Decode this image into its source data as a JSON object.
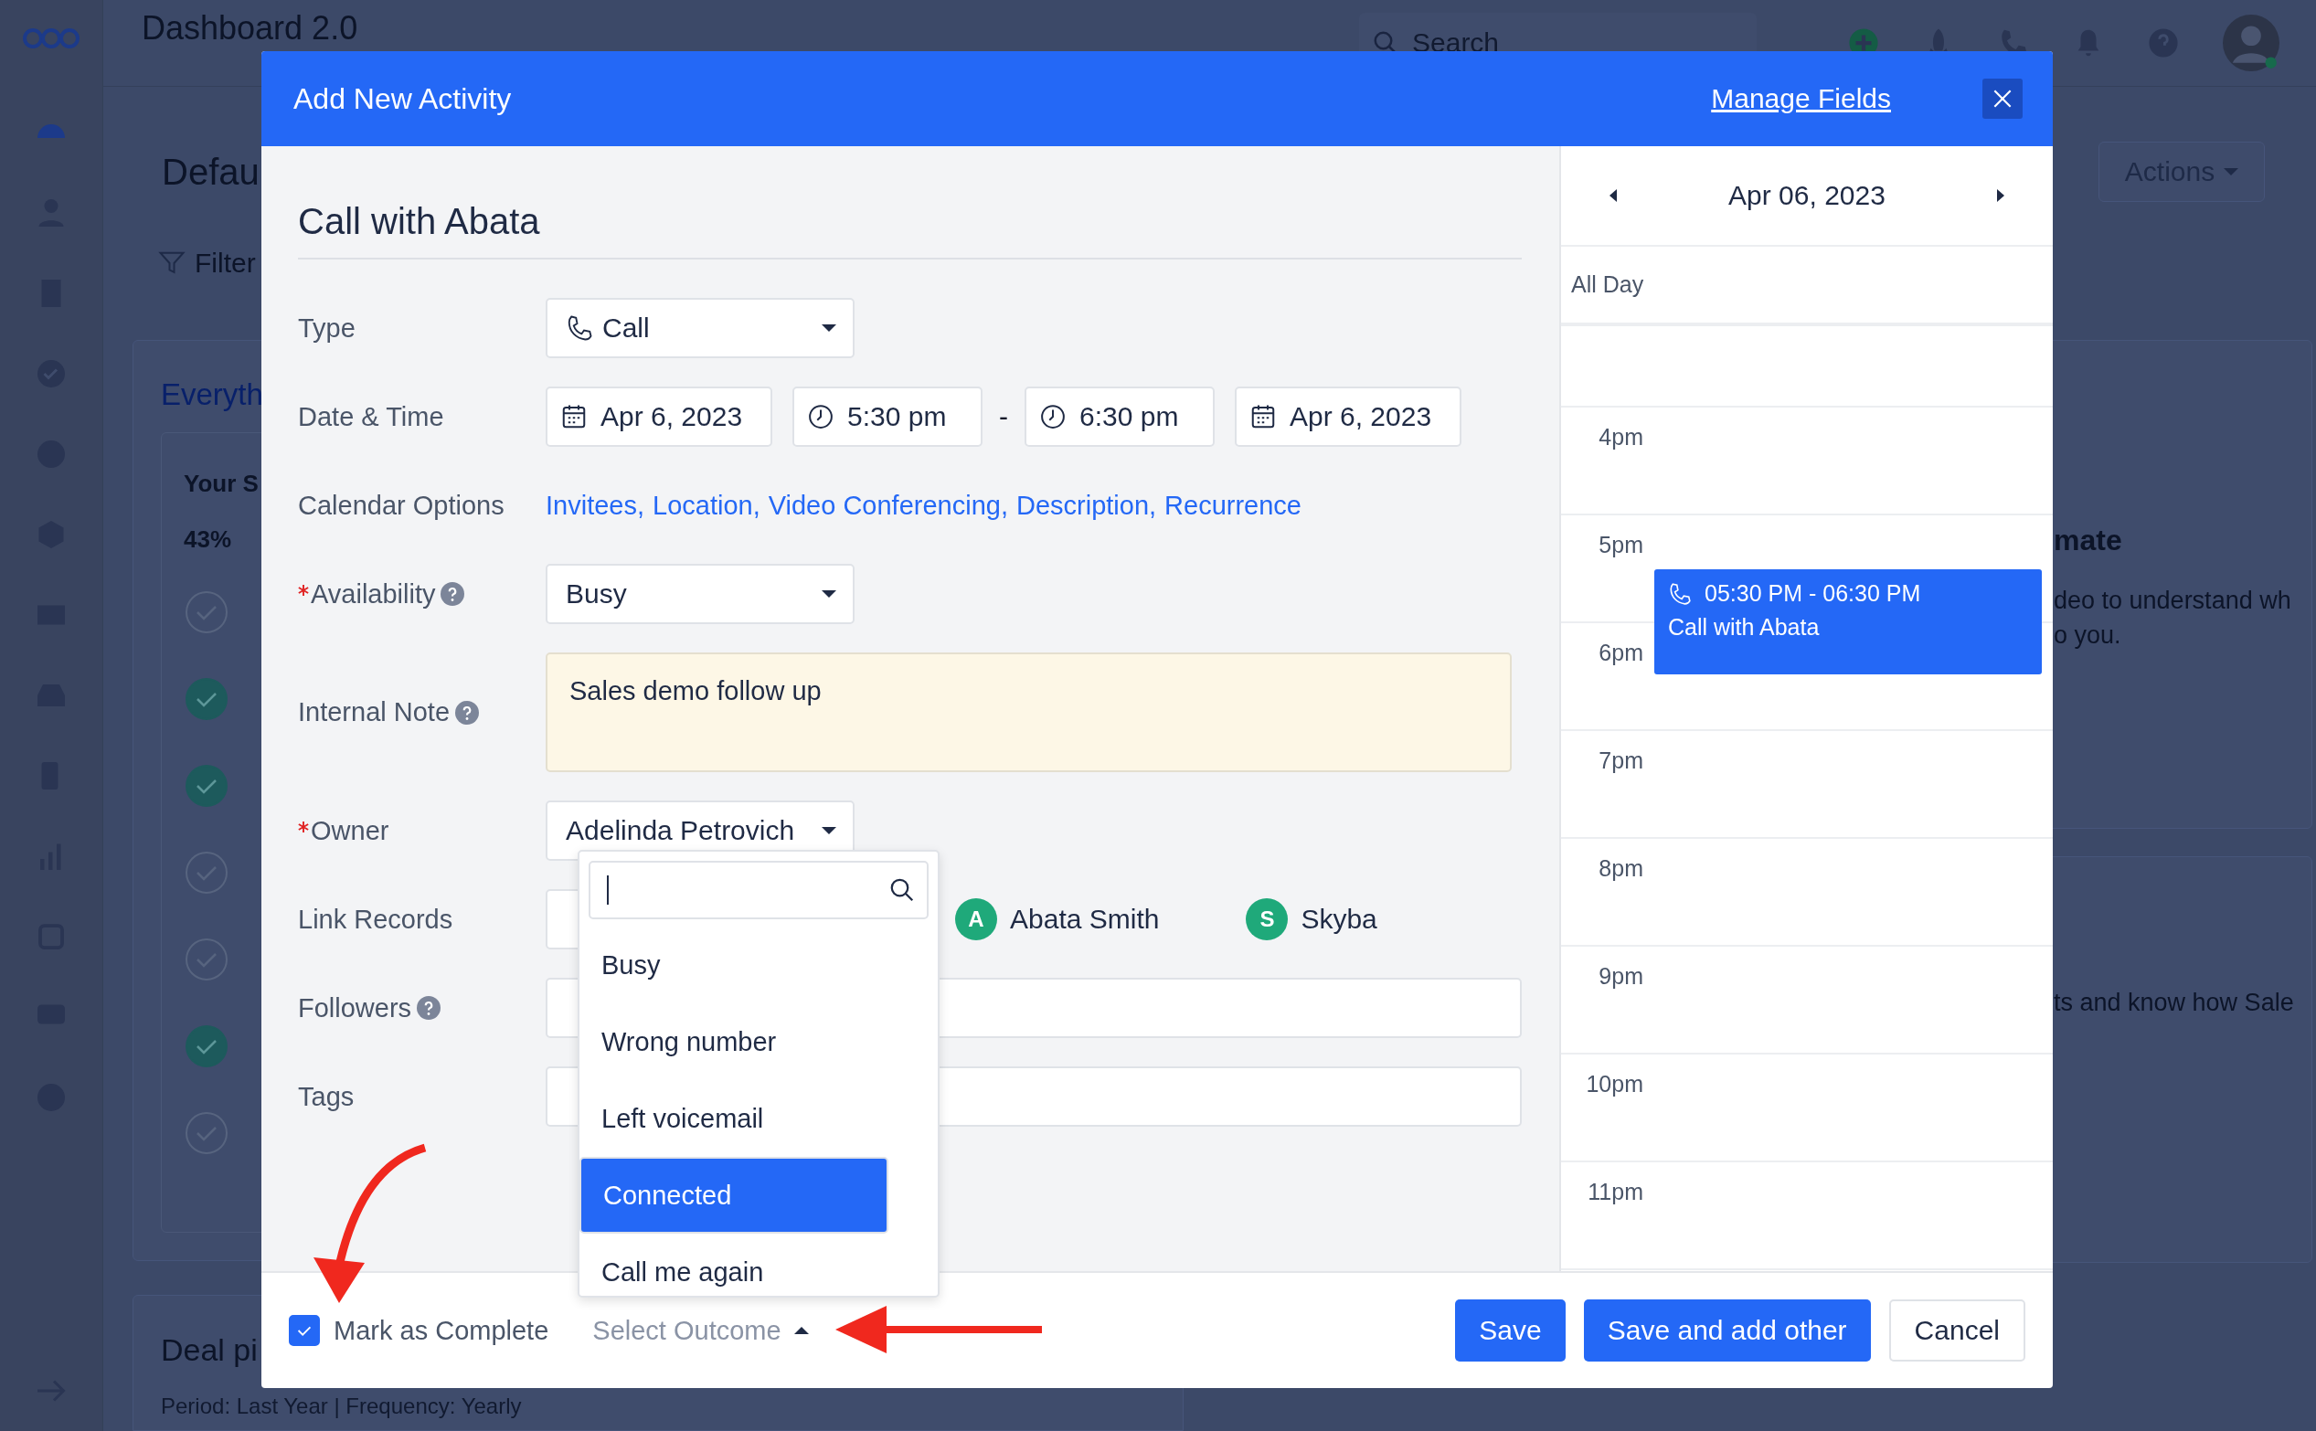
{
  "app": {
    "title": "Dashboard 2.0",
    "search": {
      "placeholder": "Search"
    }
  },
  "background": {
    "page_title": "Defau",
    "filter": "Filter",
    "actions": "Actions",
    "section_title": "Everyth",
    "subcard_title": "Your S",
    "progress": "43%",
    "checklist": [
      {
        "checked": false
      },
      {
        "checked": true
      },
      {
        "checked": true
      },
      {
        "checked": false
      },
      {
        "checked": false
      },
      {
        "checked": true
      },
      {
        "checked": false
      }
    ],
    "right_card": {
      "title": "mate",
      "lines": [
        "deo to understand wh",
        "o you."
      ]
    },
    "right_card_2": {
      "text": "ts and know how Sale"
    },
    "deal_title": "Deal pi",
    "deal_period": "Period: Last Year | Frequency: Yearly"
  },
  "modal": {
    "title": "Add New Activity",
    "manage_fields": "Manage Fields",
    "activity_title": "Call with Abata",
    "rows": [
      {
        "kind": "type-select",
        "label": "Type",
        "required": false,
        "help": false,
        "value": "Call"
      },
      {
        "kind": "datetime",
        "label": "Date & Time",
        "required": false,
        "help": false,
        "start_date": "Apr 6, 2023",
        "start_time": "5:30 pm",
        "separator": "-",
        "end_time": "6:30 pm",
        "end_date": "Apr 6, 2023"
      },
      {
        "kind": "links",
        "label": "Calendar Options",
        "required": false,
        "help": false,
        "links": [
          "Invitees,",
          "Location,",
          "Video Conferencing,",
          "Description,",
          "Recurrence"
        ]
      },
      {
        "kind": "select",
        "label": "Availability",
        "required": true,
        "help": true,
        "value": "Busy"
      },
      {
        "kind": "note",
        "label": "Internal Note",
        "required": false,
        "help": true,
        "value": "Sales demo follow up"
      },
      {
        "kind": "select",
        "label": "Owner",
        "required": true,
        "help": false,
        "value": "Adelinda Petrovich"
      },
      {
        "kind": "records",
        "label": "Link Records",
        "required": false,
        "help": false,
        "records": [
          {
            "initial": "A",
            "name": "Abata Smith"
          },
          {
            "initial": "S",
            "name": "Skyba"
          }
        ]
      },
      {
        "kind": "input",
        "label": "Followers",
        "required": false,
        "help": true
      },
      {
        "kind": "input",
        "label": "Tags",
        "required": false,
        "help": false
      }
    ],
    "outcome_menu": {
      "options": [
        {
          "label": "Busy",
          "selected": false
        },
        {
          "label": "Wrong number",
          "selected": false
        },
        {
          "label": "Left voicemail",
          "selected": false
        },
        {
          "label": "Connected",
          "selected": true
        },
        {
          "label": "Call me again",
          "selected": false
        }
      ]
    },
    "footer": {
      "mark_complete": {
        "label": "Mark as Complete",
        "checked": true
      },
      "outcome": {
        "placeholder": "Select Outcome",
        "expanded": true
      },
      "buttons": [
        {
          "label": "Save",
          "kind": "primary"
        },
        {
          "label": "Save and add other",
          "kind": "primary"
        },
        {
          "label": "Cancel",
          "kind": "secondary"
        }
      ]
    },
    "calendar": {
      "date": "Apr 06, 2023",
      "all_day": "All Day",
      "hours": [
        "4pm",
        "5pm",
        "6pm",
        "7pm",
        "8pm",
        "9pm",
        "10pm",
        "11pm"
      ],
      "event": {
        "time": "05:30 PM - 06:30 PM",
        "title": "Call with Abata"
      }
    }
  }
}
